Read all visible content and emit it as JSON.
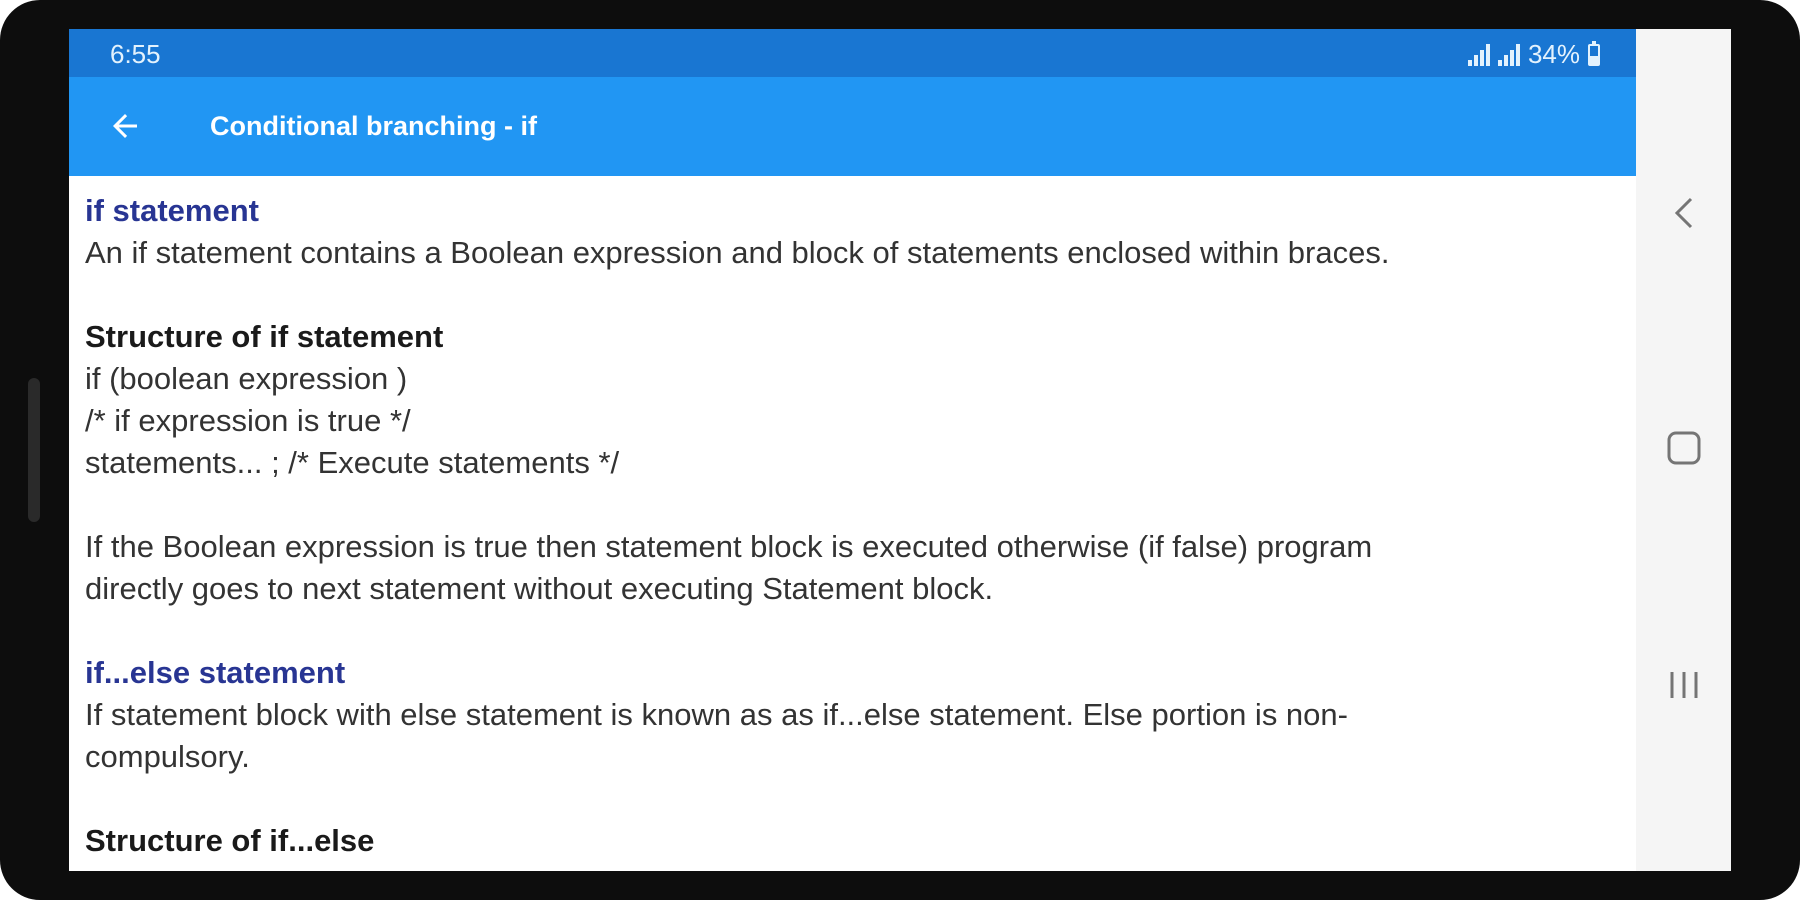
{
  "status_bar": {
    "time": "6:55",
    "battery_text": "34%"
  },
  "app_bar": {
    "title": "Conditional branching - if",
    "back_icon": "arrow-left-icon"
  },
  "content": {
    "if_heading": "if statement",
    "if_description": "An if statement contains a Boolean expression and block of statements enclosed within braces.",
    "if_structure_heading": "Structure of if statement",
    "if_structure_lines": [
      "if (boolean expression )",
      "/* if expression is true */",
      "statements... ; /* Execute statements */"
    ],
    "if_explanation_1": "If the Boolean expression is true then statement block is executed otherwise (if false) program",
    "if_explanation_2": "directly goes to next statement without executing Statement block.",
    "ifelse_heading": "if...else statement",
    "ifelse_description_1": "If statement block with else statement is known as as if...else statement. Else portion is non-",
    "ifelse_description_2": "compulsory.",
    "ifelse_structure_heading": "Structure of if...else"
  },
  "nav_bar": {
    "icons": [
      "back-chevron-icon",
      "home-square-icon",
      "recents-icon"
    ]
  },
  "colors": {
    "status_bar": "#1976d2",
    "app_bar": "#2196f3",
    "heading_blue": "#283593",
    "text": "#333333"
  }
}
